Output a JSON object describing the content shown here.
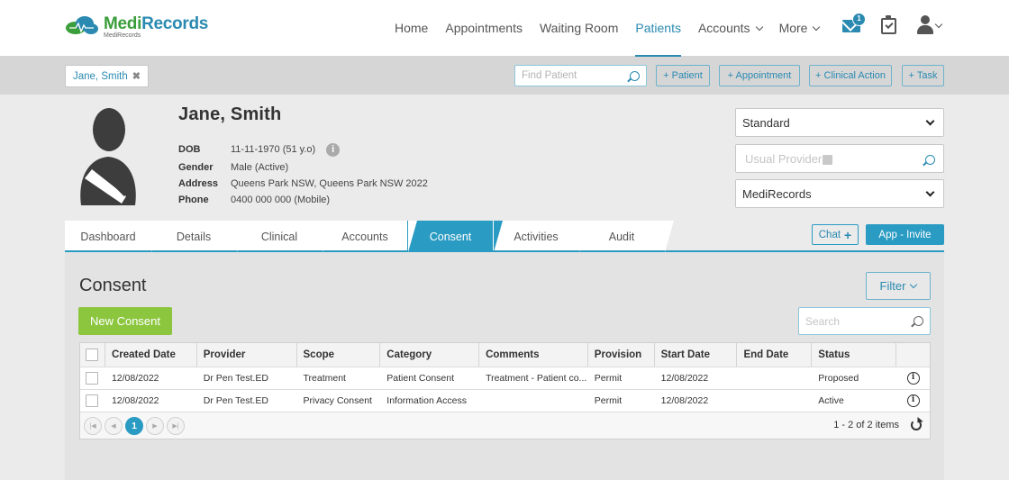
{
  "app": {
    "name_prefix": "Medi",
    "name_suffix": "Records",
    "subtitle": "MediRecords"
  },
  "nav": {
    "items": [
      {
        "label": "Home",
        "active": false,
        "dropdown": false
      },
      {
        "label": "Appointments",
        "active": false,
        "dropdown": false
      },
      {
        "label": "Waiting Room",
        "active": false,
        "dropdown": false
      },
      {
        "label": "Patients",
        "active": true,
        "dropdown": false
      },
      {
        "label": "Accounts",
        "active": false,
        "dropdown": true
      },
      {
        "label": "More",
        "active": false,
        "dropdown": true
      }
    ],
    "mail_badge": "1",
    "icons": [
      "envelope-icon",
      "clipboard-check-icon",
      "user-icon"
    ]
  },
  "toolbar": {
    "patient_chip": "Jane, Smith",
    "find_patient_placeholder": "Find Patient",
    "buttons": [
      "+ Patient",
      "+ Appointment",
      "+ Clinical Action",
      "+ Task"
    ]
  },
  "patient": {
    "name": "Jane, Smith",
    "fields": [
      {
        "label": "DOB",
        "value": "11-11-1970 (51 y.o)"
      },
      {
        "label": "Gender",
        "value": "Male (Active)"
      },
      {
        "label": "Address",
        "value": "Queens Park NSW, Queens Park NSW 2022"
      },
      {
        "label": "Phone",
        "value": "0400 000 000 (Mobile)"
      }
    ]
  },
  "side": {
    "billing_type": "Standard",
    "usual_provider_placeholder": "Usual Provider",
    "practice": "MediRecords"
  },
  "tabs": [
    {
      "label": "Dashboard",
      "active": false
    },
    {
      "label": "Details",
      "active": false
    },
    {
      "label": "Clinical",
      "active": false
    },
    {
      "label": "Accounts",
      "active": false
    },
    {
      "label": "Consent",
      "active": true
    },
    {
      "label": "Activities",
      "active": false
    },
    {
      "label": "Audit",
      "active": false
    }
  ],
  "actions": {
    "chat": "Chat",
    "app_invite": "App - Invite"
  },
  "consent": {
    "title": "Consent",
    "filter": "Filter",
    "new_button": "New Consent",
    "search_placeholder": "Search",
    "columns": [
      "Created Date",
      "Provider",
      "Scope",
      "Category",
      "Comments",
      "Provision",
      "Start Date",
      "End Date",
      "Status"
    ],
    "rows": [
      [
        "12/08/2022",
        "Dr Pen Test.ED",
        "Treatment",
        "Patient Consent",
        "Treatment - Patient co...",
        "Permit",
        "12/08/2022",
        "",
        "Proposed"
      ],
      [
        "12/08/2022",
        "Dr Pen Test.ED",
        "Privacy Consent",
        "Information Access",
        "",
        "Permit",
        "12/08/2022",
        "",
        "Active"
      ]
    ],
    "pager": {
      "current_page": "1",
      "summary": "1 - 2 of 2 items"
    }
  },
  "colors": {
    "accent": "#2a9bc2",
    "brand_blue": "#2a8ab1",
    "brand_green": "#3a9e3a",
    "new_button": "#8cc63f"
  }
}
